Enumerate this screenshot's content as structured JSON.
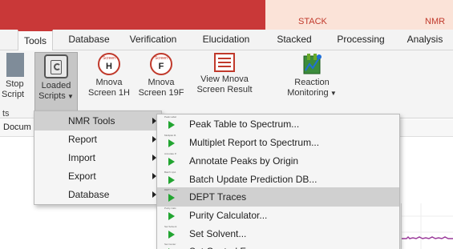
{
  "contextual": {
    "stack_label": "STACK",
    "nmr_label": "NMR"
  },
  "tabs": [
    {
      "label": "Tools",
      "active": true
    },
    {
      "label": "Database"
    },
    {
      "label": "Verification"
    },
    {
      "label": "Elucidation"
    },
    {
      "label": "Stacked"
    },
    {
      "label": "Processing"
    },
    {
      "label": "Analysis"
    }
  ],
  "ribbon": {
    "stop_line1": "Stop",
    "stop_line2": "Script",
    "loaded_line1": "Loaded",
    "loaded_line2": "Scripts",
    "mnova1h_line1": "Mnova",
    "mnova1h_line2": "Screen 1H",
    "mnova1h_icon_text": "Screen",
    "mnova1h_icon_letter": "H",
    "mnova19f_line1": "Mnova",
    "mnova19f_line2": "Screen 19F",
    "mnova19f_icon_text": "Screen",
    "mnova19f_icon_letter": "F",
    "viewmnova_line1": "View Mnova",
    "viewmnova_line2": "Screen Result",
    "reaction_line1": "Reaction",
    "reaction_line2": "Monitoring",
    "group_label_fragment": "ts"
  },
  "doc_fragment": "Docum",
  "menu_main": [
    "NMR Tools",
    "Report",
    "Import",
    "Export",
    "Database"
  ],
  "menu_sub": [
    {
      "label": "Peak Table to Spectrum...",
      "tag": "Peak Label"
    },
    {
      "label": "Multiplet Report to Spectrum...",
      "tag": "Multiplet R."
    },
    {
      "label": "Annotate Peaks by Origin",
      "tag": "Annotate P."
    },
    {
      "label": "Batch Update Prediction DB...",
      "tag": "Batch Upd."
    },
    {
      "label": "DEPT Traces",
      "tag": "DEPT Trace"
    },
    {
      "label": "Purity Calculator...",
      "tag": "Purity Calc."
    },
    {
      "label": "Set Solvent...",
      "tag": "Set Solvent"
    },
    {
      "label": "Set Central Frequency...",
      "tag": "Set Center"
    }
  ],
  "colors": {
    "brand_red": "#c93838",
    "contextual_tint": "#fbe3d8",
    "highlight": "#d0d0d0",
    "play_green": "#22a531"
  }
}
